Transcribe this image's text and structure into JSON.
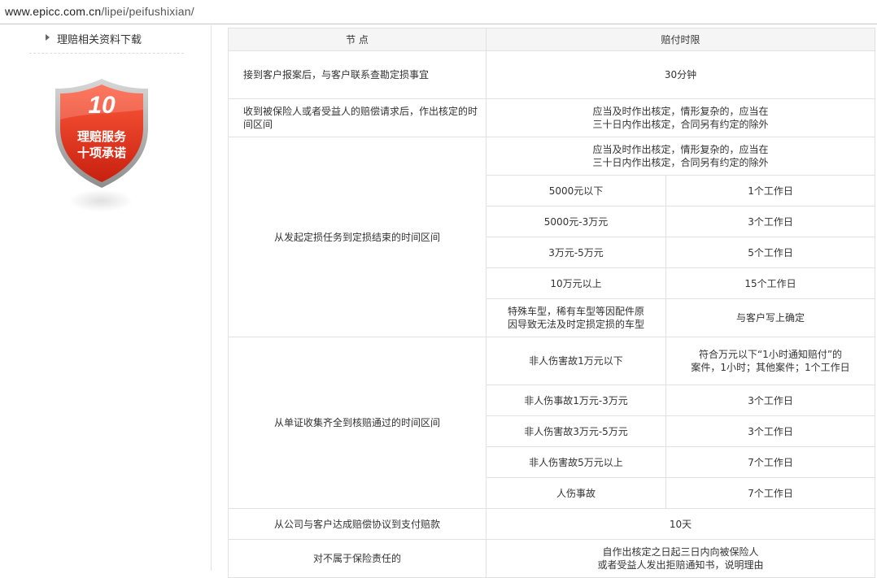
{
  "browser": {
    "url_domain": "www.epicc.com.cn",
    "url_path": "/lipei/peifushixian/"
  },
  "sidebar": {
    "link_label": "理赔相关资料下载",
    "badge": {
      "number": "10",
      "line1": "理赔服务",
      "line2": "十项承诺",
      "color_primary": "#e0301e",
      "color_border": "#9a9a9a"
    }
  },
  "table": {
    "headers": [
      "节 点",
      "赔付时限"
    ],
    "row1": {
      "node": "接到客户报案后，与客户联系查勘定损事宜",
      "limit": "30分钟"
    },
    "row2": {
      "node": "收到被保险人或者受益人的赔偿请求后，作出核定的时间区间",
      "limit1": "应当及时作出核定，情形复杂的，应当在",
      "limit2": "三十日内作出核定，合同另有约定的除外"
    },
    "row3": {
      "node": "从发起定损任务到定损结束的时间区间",
      "limit1": "应当及时作出核定，情形复杂的，应当在",
      "limit2": "三十日内作出核定，合同另有约定的除外",
      "sub": [
        {
          "cond": "5000元以下",
          "time": "1个工作日"
        },
        {
          "cond": "5000元-3万元",
          "time": "3个工作日"
        },
        {
          "cond": "3万元-5万元",
          "time": "5个工作日"
        },
        {
          "cond": "10万元以上",
          "time": "15个工作日"
        },
        {
          "cond1": "特殊车型，稀有车型等因配件原",
          "cond2": "因导致无法及时定损定损的车型",
          "time": "与客户写上确定"
        }
      ]
    },
    "row4": {
      "node": "从单证收集齐全到核赔通过的时间区间",
      "sub": [
        {
          "cond": "非人伤害故1万元以下",
          "time1": "符合万元以下“1小时通知赔付”的",
          "time2": "案件，1小时；其他案件；1个工作日"
        },
        {
          "cond": "非人伤事故1万元-3万元",
          "time": "3个工作日"
        },
        {
          "cond": "非人伤害故3万元-5万元",
          "time": "3个工作日"
        },
        {
          "cond": "非人伤害故5万元以上",
          "time": "7个工作日"
        },
        {
          "cond": "人伤事故",
          "time": "7个工作日"
        }
      ]
    },
    "row5": {
      "node": "从公司与客户达成赔偿协议到支付赔款",
      "limit": "10天"
    },
    "row6": {
      "node": "对不属于保险责任的",
      "limit1": "自作出核定之日起三日内向被保险人",
      "limit2": "或者受益人发出拒赔通知书，说明理由"
    }
  }
}
